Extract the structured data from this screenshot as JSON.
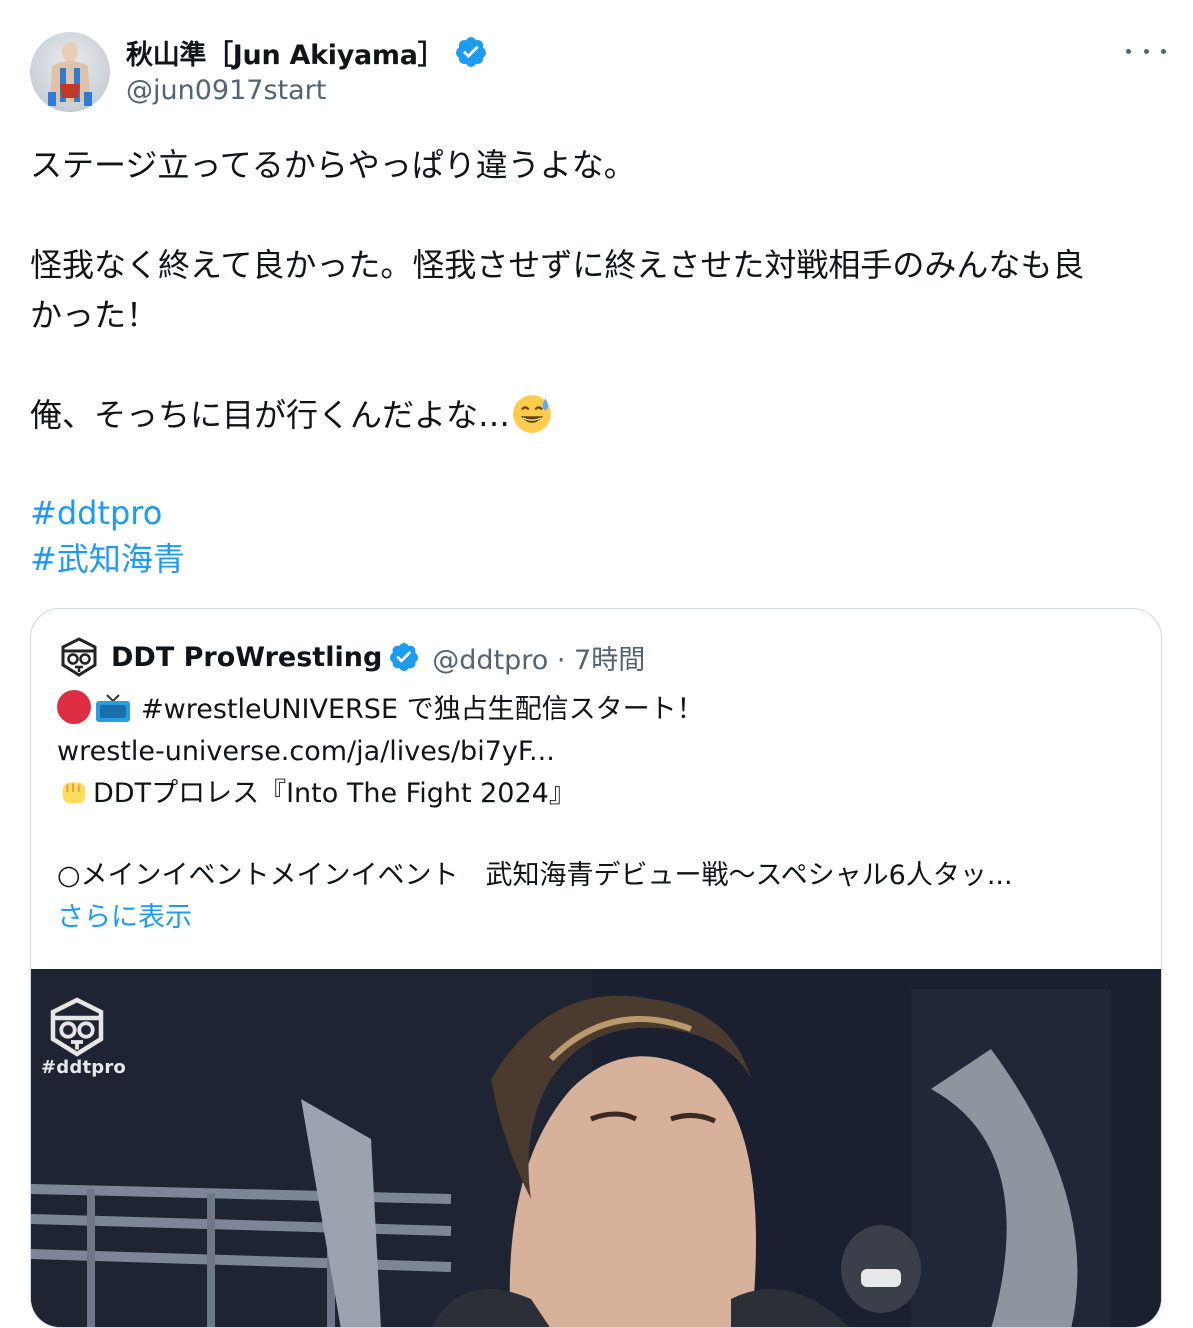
{
  "author": {
    "display_name": "秋山準［Jun Akiyama］",
    "handle": "@jun0917start"
  },
  "tweet": {
    "line1": "ステージ立ってるからやっぱり違うよな。",
    "line2": "怪我なく終えて良かった。怪我させずに終えさせた対戦相手のみんなも良",
    "line3": "かった！",
    "line4": "俺、そっちに目が行くんだよな…",
    "hashtags": [
      "#ddtpro",
      "#武知海青"
    ]
  },
  "quoted": {
    "display_name": "DDT ProWrestling",
    "handle_time": "@ddtpro · 7時間",
    "line1": "#wrestleUNIVERSE で独占生配信スタート！",
    "line2": "wrestle-universe.com/ja/lives/bi7yF...",
    "line3": "DDTプロレス『Into The Fight 2024』",
    "line4": "○メインイベントメインイベント　武知海青デビュー戦～スペシャル6人タッ...",
    "show_more": "さらに表示",
    "media_tag": "#ddtpro"
  },
  "colors": {
    "link": "#1d9bf0",
    "verified": "#1d9bf0",
    "secondary_text": "#536471",
    "border": "#cfd9de"
  },
  "icons": [
    "verified-badge-icon",
    "more-icon",
    "sweat-smile-emoji",
    "red-circle-emoji",
    "tv-emoji",
    "fist-emoji",
    "ddt-logo-icon"
  ]
}
